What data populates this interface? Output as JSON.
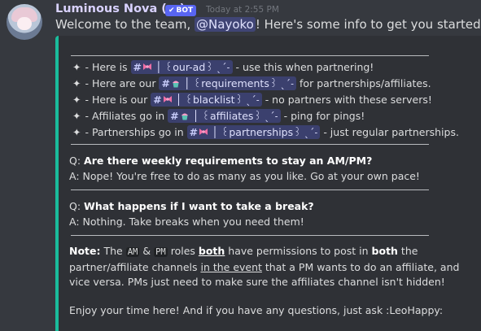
{
  "author": {
    "name": "Luminous Nova (n.)",
    "badge": "BOT",
    "timestamp": "Today at 2:55 PM"
  },
  "message": {
    "prefix": "Welcome to the team, ",
    "mention": "@Nayoko",
    "suffix": "! Here's some info to get you started:"
  },
  "channels": [
    {
      "prefix": "- Here is ",
      "name": "꒰our-ad꒱ ˎˊ˗",
      "suffix": " - use this when partnering!",
      "emoji": "ribbon"
    },
    {
      "prefix": "- Here are our ",
      "name": "꒰requirements꒱ ˎˊ˗",
      "suffix": " for partnerships/affiliates.",
      "emoji": "cupcake"
    },
    {
      "prefix": "- Here is our ",
      "name": "꒰blacklist꒱ ˎˊ˗",
      "suffix": " - no partners with these servers!",
      "emoji": "ribbon"
    },
    {
      "prefix": "- Affiliates go in ",
      "name": "꒰affiliates꒱ ˎˊ˗",
      "suffix": " - ping for pings!",
      "emoji": "cupcake"
    },
    {
      "prefix": "- Partnerships go in ",
      "name": "꒰partnerships꒱ ˎˊ˗",
      "suffix": " - just regular partnerships.",
      "emoji": "ribbon"
    }
  ],
  "faq": [
    {
      "q_prefix": "Q: ",
      "q": "Are there weekly requirements to stay an AM/PM?",
      "a": "A: Nope! You're free to do as many as you like. Go at your own pace!"
    },
    {
      "q_prefix": "Q: ",
      "q": "What happens if I want to take a break?",
      "a": "A: Nothing. Take breaks when you need them!"
    }
  ],
  "note": {
    "label": "Note:",
    "t1": " The ",
    "am": "AM",
    "t2": " & ",
    "pm": "PM",
    "t3": " roles ",
    "both1": "both",
    "t4": " have permissions to post in ",
    "both2": "both",
    "t5": " the partner/affiliate channels ",
    "event": "in the event",
    "t6": " that a PM wants to do an affiliate, and vice versa. PMs just need to make sure the affiliates channel isn't hidden!"
  },
  "closing": "Enjoy your time here! And if you have any questions, just ask :LeoHappy:",
  "colors": {
    "embed_border": "#1abc9c",
    "bot_badge": "#5865f2",
    "background": "#36393f",
    "embed_bg": "#2f3136"
  }
}
